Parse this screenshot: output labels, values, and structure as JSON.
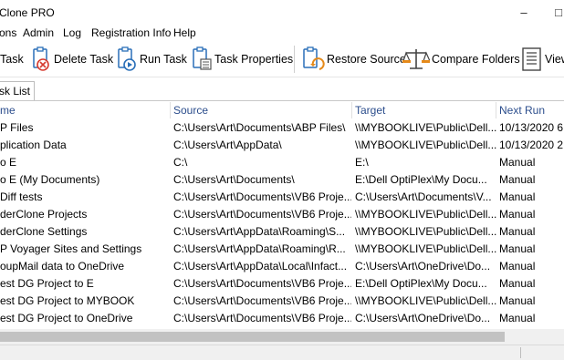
{
  "window": {
    "title": "Clone PRO",
    "minimize_glyph": "–",
    "maximize_glyph": "□"
  },
  "menu": [
    "ons",
    "Admin",
    "Log",
    "Registration Info",
    "Help"
  ],
  "toolbar": {
    "buttons": [
      {
        "label": "Task",
        "icon": "new-task-icon"
      },
      {
        "label": "Delete Task",
        "icon": "delete-task-icon"
      },
      {
        "label": "Run Task",
        "icon": "run-task-icon"
      },
      {
        "label": "Task Properties",
        "icon": "task-properties-icon"
      },
      {
        "label": "Restore Source",
        "icon": "restore-source-icon"
      },
      {
        "label": "Compare Folders",
        "icon": "compare-folders-icon"
      },
      {
        "label": "View",
        "icon": "view-icon"
      }
    ]
  },
  "tab": {
    "label": "sk List"
  },
  "table": {
    "columns": [
      "me",
      "Source",
      "Target",
      "Next Run"
    ],
    "rows": [
      [
        "P Files",
        "C:\\Users\\Art\\Documents\\ABP Files\\",
        "\\\\MYBOOKLIVE\\Public\\Dell...",
        "10/13/2020 6:"
      ],
      [
        "plication Data",
        "C:\\Users\\Art\\AppData\\",
        "\\\\MYBOOKLIVE\\Public\\Dell...",
        "10/13/2020 2:"
      ],
      [
        "o E",
        "C:\\",
        "E:\\",
        "Manual"
      ],
      [
        "o E (My Documents)",
        "C:\\Users\\Art\\Documents\\",
        "E:\\Dell OptiPlex\\My Docu...",
        "Manual"
      ],
      [
        "Diff tests",
        "C:\\Users\\Art\\Documents\\VB6 Proje...",
        "C:\\Users\\Art\\Documents\\V...",
        "Manual"
      ],
      [
        "derClone Projects",
        "C:\\Users\\Art\\Documents\\VB6 Proje...",
        "\\\\MYBOOKLIVE\\Public\\Dell...",
        "Manual"
      ],
      [
        "derClone Settings",
        "C:\\Users\\Art\\AppData\\Roaming\\S...",
        "\\\\MYBOOKLIVE\\Public\\Dell...",
        "Manual"
      ],
      [
        "P Voyager Sites and Settings",
        "C:\\Users\\Art\\AppData\\Roaming\\R...",
        "\\\\MYBOOKLIVE\\Public\\Dell...",
        "Manual"
      ],
      [
        "oupMail data to OneDrive",
        "C:\\Users\\Art\\AppData\\Local\\Infact...",
        "C:\\Users\\Art\\OneDrive\\Do...",
        "Manual"
      ],
      [
        "est DG Project to E",
        "C:\\Users\\Art\\Documents\\VB6 Proje...",
        "E:\\Dell OptiPlex\\My Docu...",
        "Manual"
      ],
      [
        "est DG Project to MYBOOK",
        "C:\\Users\\Art\\Documents\\VB6 Proje...",
        "\\\\MYBOOKLIVE\\Public\\Dell...",
        "Manual"
      ],
      [
        "est DG Project to OneDrive",
        "C:\\Users\\Art\\Documents\\VB6 Proje...",
        "C:\\Users\\Art\\OneDrive\\Do...",
        "Manual"
      ]
    ]
  },
  "colors": {
    "header_text": "#2b4d8c",
    "icon_blue": "#2a6fb8",
    "delete_red": "#d63a2f",
    "restore_orange": "#e58a1a"
  }
}
